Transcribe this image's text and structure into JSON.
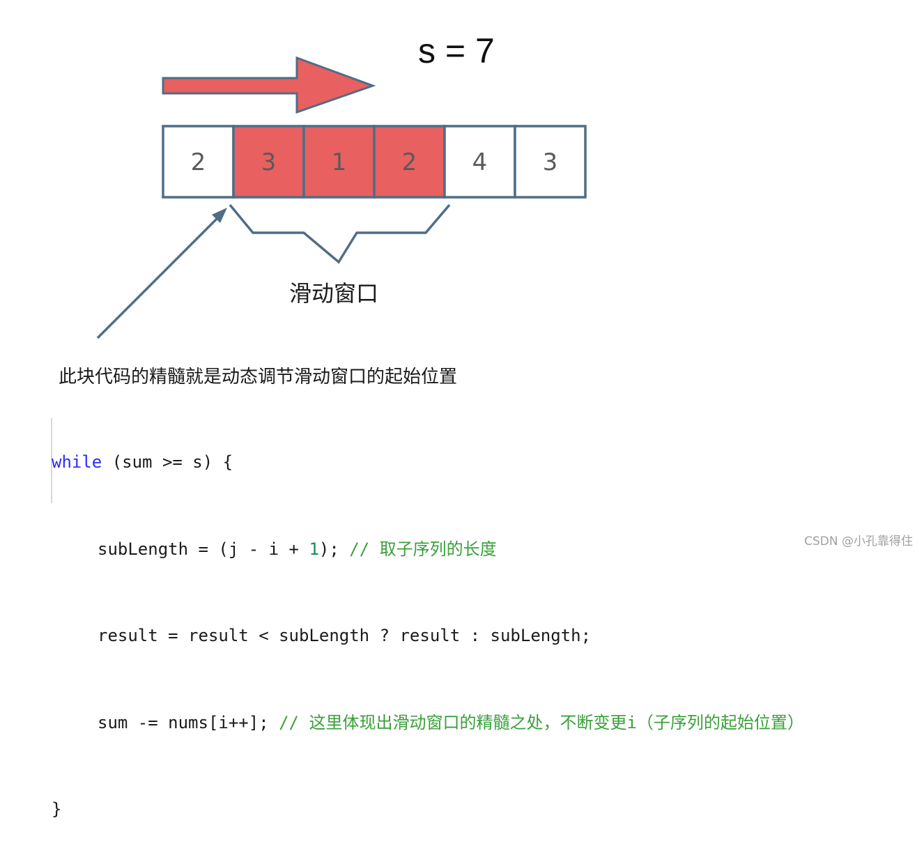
{
  "title": "s = 7",
  "array": [
    {
      "value": "2",
      "in_window": false
    },
    {
      "value": "3",
      "in_window": true
    },
    {
      "value": "1",
      "in_window": true
    },
    {
      "value": "2",
      "in_window": true
    },
    {
      "value": "4",
      "in_window": false
    },
    {
      "value": "3",
      "in_window": false
    }
  ],
  "window_label": "滑动窗口",
  "caption": "此块代码的精髓就是动态调节滑动窗口的起始位置",
  "code": {
    "line1_kw": "while",
    "line1_rest": " (sum >= s) {",
    "line2_code_a": "subLength = (j - i + ",
    "line2_num": "1",
    "line2_code_b": "); ",
    "line2_comment": "// 取子序列的长度",
    "line3_code": "result = result < subLength ? result : subLength;",
    "line4_code": "sum -= nums[i++]; ",
    "line4_comment": "// 这里体现出滑动窗口的精髓之处，不断变更i（子序列的起始位置）",
    "line5": "}"
  },
  "colors": {
    "window_fill": "#e86060",
    "outline": "#4f6d86",
    "keyword": "#2b2bff",
    "comment": "#3aa03a"
  },
  "watermark": "CSDN @小孔靠得住"
}
